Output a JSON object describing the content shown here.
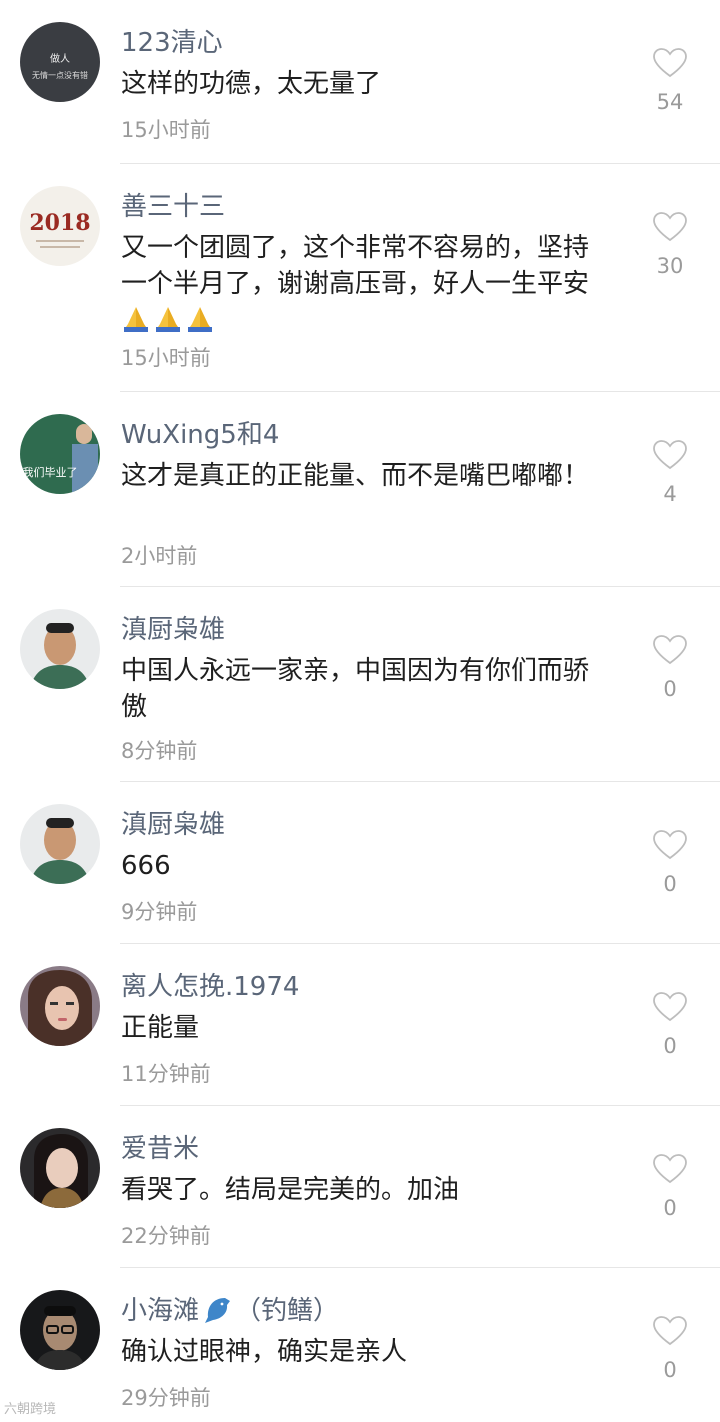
{
  "comments": [
    {
      "name": "123清心",
      "text": "这样的功德，太无量了",
      "time": "15小时前",
      "likes": "54",
      "avatar_text": [
        "做人",
        "无情一点没有错"
      ]
    },
    {
      "name": "善三十三",
      "text": "又一个团圆了，这个非常不容易的，坚持一个半月了，谢谢高压哥，好人一生平安",
      "time": "15小时前",
      "likes": "30",
      "avatar_text": [
        "2018"
      ]
    },
    {
      "name": "WuXing5和4",
      "text": "这才是真正的正能量、而不是嘴巴嘟嘟！",
      "time": "2小时前",
      "likes": "4",
      "avatar_text": [
        "我们毕业了"
      ]
    },
    {
      "name": "滇厨枭雄",
      "text": "中国人永远一家亲，中国因为有你们而骄傲",
      "time": "8分钟前",
      "likes": "0"
    },
    {
      "name": "滇厨枭雄",
      "text": "666",
      "time": "9分钟前",
      "likes": "0"
    },
    {
      "name": "离人怎挽.1974",
      "text": "正能量",
      "time": "11分钟前",
      "likes": "0"
    },
    {
      "name": "爱昔米",
      "text": "看哭了。结局是完美的。加油",
      "time": "22分钟前",
      "likes": "0"
    },
    {
      "name": "小海滩",
      "name_suffix": "（钓鳝）",
      "text": "确认过眼神，确实是亲人",
      "time": "29分钟前",
      "likes": "0"
    }
  ],
  "watermark": "六朝跨境",
  "icons": {
    "like": "heart-outline-icon",
    "pray": "pray-emoji-icon",
    "dolphin": "dolphin-emoji-icon"
  },
  "colors": {
    "name": "#5a6678",
    "text": "#1f1f1f",
    "meta": "#9a9a9a",
    "divider": "#e6e6e6"
  }
}
